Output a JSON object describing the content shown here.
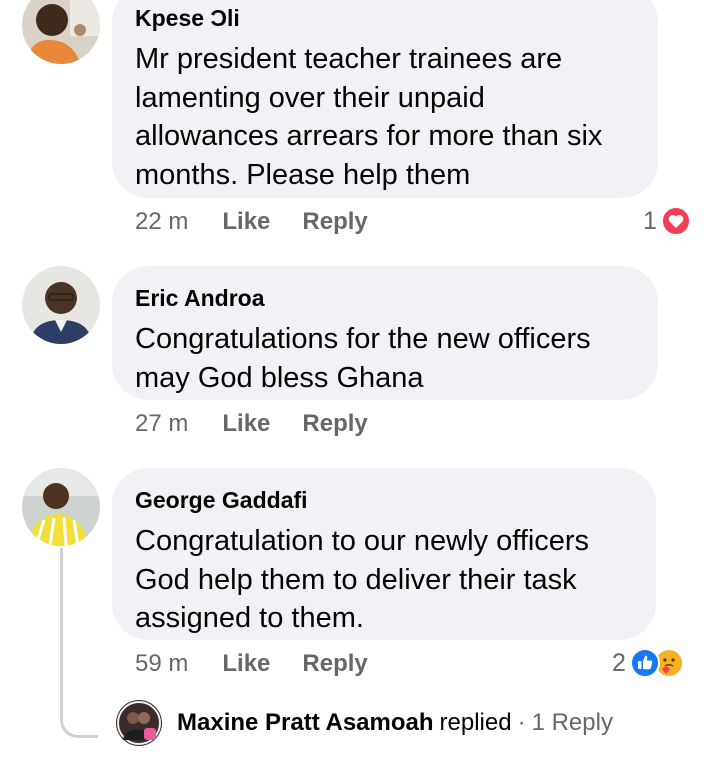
{
  "colors": {
    "bubble_bg": "#f0f2f5",
    "secondary_text": "#65676b",
    "love_red": "#f33e58",
    "like_blue": "#1877f2",
    "care_yellow": "#f7b125"
  },
  "comments": [
    {
      "author": "Kpese Ɔli",
      "text": "Mr president teacher trainees are lamenting over their unpaid allowances arrears for more than six months. Please help them",
      "time": "22 m",
      "like_label": "Like",
      "reply_label": "Reply",
      "reaction_count": "1",
      "reactions": [
        "love-icon"
      ]
    },
    {
      "author": "Eric Androa",
      "text": "Congratulations for the new officers may God bless Ghana",
      "time": "27 m",
      "like_label": "Like",
      "reply_label": "Reply"
    },
    {
      "author": "George Gaddafi",
      "text": "Congratulation to our newly officers God help them to deliver their task assigned to them.",
      "time": "59 m",
      "like_label": "Like",
      "reply_label": "Reply",
      "reaction_count": "2",
      "reactions": [
        "like-icon",
        "care-icon"
      ]
    }
  ],
  "reply_preview": {
    "name": "Maxine Pratt Asamoah",
    "verb": "replied",
    "separator": "·",
    "count": "1 Reply"
  }
}
